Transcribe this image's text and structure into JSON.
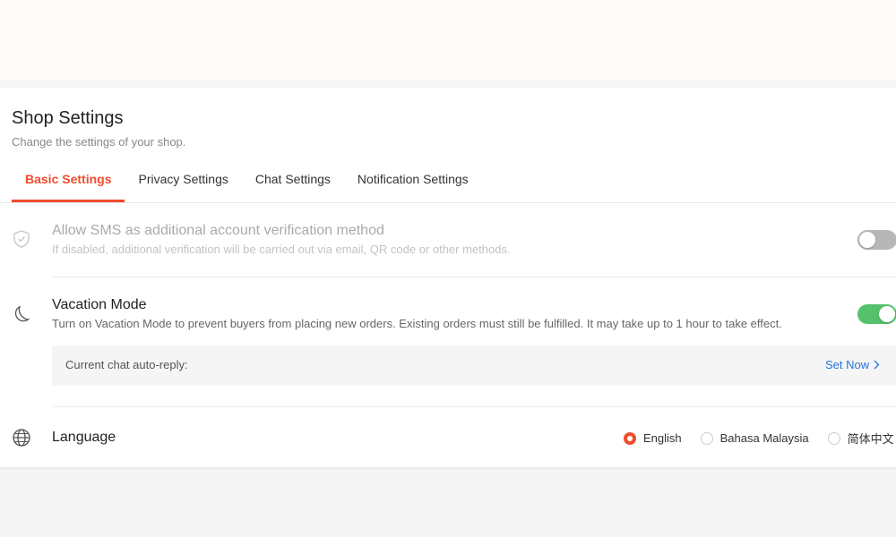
{
  "header": {
    "title": "Shop Settings",
    "subtitle": "Change the settings of your shop."
  },
  "tabs": [
    {
      "label": "Basic Settings",
      "active": true
    },
    {
      "label": "Privacy Settings",
      "active": false
    },
    {
      "label": "Chat Settings",
      "active": false
    },
    {
      "label": "Notification Settings",
      "active": false
    }
  ],
  "settings": {
    "sms": {
      "title": "Allow SMS as additional account verification method",
      "description": "If disabled, additional verification will be carried out via email, QR code or other methods.",
      "enabled": false,
      "icon": "shield-check-icon"
    },
    "vacation": {
      "title": "Vacation Mode",
      "description": "Turn on Vacation Mode to prevent buyers from placing new orders. Existing orders must still be fulfilled. It may take up to 1 hour to take effect.",
      "enabled": true,
      "icon": "moon-icon",
      "auto_reply_label": "Current chat auto-reply:",
      "set_now_label": "Set Now"
    },
    "language": {
      "title": "Language",
      "icon": "globe-icon",
      "options": [
        {
          "label": "English",
          "selected": true
        },
        {
          "label": "Bahasa Malaysia",
          "selected": false
        },
        {
          "label": "简体中文",
          "selected": false
        }
      ]
    }
  },
  "colors": {
    "accent": "#ee4d2d",
    "toggle_on": "#55c26b",
    "toggle_off": "#b7b7b7",
    "link": "#2673dd"
  }
}
